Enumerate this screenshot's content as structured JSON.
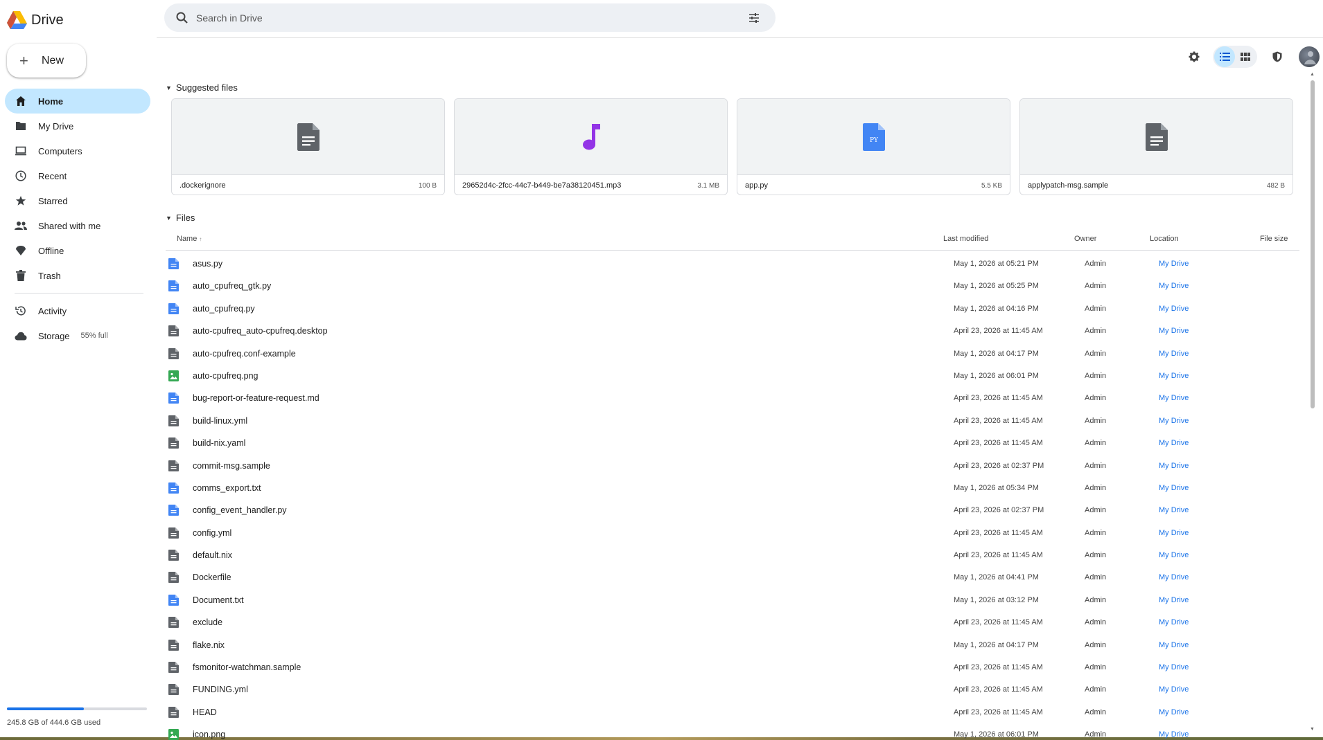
{
  "app": {
    "title": "Drive"
  },
  "sidebar": {
    "new_label": "New",
    "items": [
      {
        "label": "Home",
        "icon": "home-icon",
        "active": true
      },
      {
        "label": "My Drive",
        "icon": "folder-icon"
      },
      {
        "label": "Computers",
        "icon": "computer-icon"
      },
      {
        "label": "Recent",
        "icon": "clock-icon"
      },
      {
        "label": "Starred",
        "icon": "star-icon"
      },
      {
        "label": "Shared with me",
        "icon": "people-icon"
      },
      {
        "label": "Offline",
        "icon": "offline-icon"
      },
      {
        "label": "Trash",
        "icon": "trash-icon"
      }
    ],
    "items2": [
      {
        "label": "Activity",
        "icon": "history-icon"
      },
      {
        "label": "Storage",
        "icon": "cloud-icon",
        "extra": "55% full"
      }
    ],
    "storage_used_fraction": 0.55,
    "storage_text": "245.8 GB of 444.6 GB used"
  },
  "search": {
    "placeholder": "Search in Drive"
  },
  "sections": {
    "suggested": "Suggested files",
    "files": "Files"
  },
  "suggested": [
    {
      "name": ".dockerignore",
      "size": "100 B",
      "icon": "document-icon"
    },
    {
      "name": "29652d4c-2fcc-44c7-b449-be7a38120451.mp3",
      "size": "3.1 MB",
      "icon": "music-icon"
    },
    {
      "name": "app.py",
      "size": "5.5 KB",
      "icon": "python-file-icon"
    },
    {
      "name": "applypatch-msg.sample",
      "size": "482 B",
      "icon": "document-icon"
    }
  ],
  "table": {
    "headers": {
      "name": "Name",
      "sort": "↑",
      "modified": "Last modified",
      "owner": "Owner",
      "location": "Location",
      "size": "File size"
    },
    "rows": [
      {
        "name": "asus.py",
        "modified": "May 1, 2026 at 05:21 PM",
        "owner": "Admin",
        "location": "My Drive",
        "type": "blue"
      },
      {
        "name": "auto_cpufreq_gtk.py",
        "modified": "May 1, 2026 at 05:25 PM",
        "owner": "Admin",
        "location": "My Drive",
        "type": "blue"
      },
      {
        "name": "auto_cpufreq.py",
        "modified": "May 1, 2026 at 04:16 PM",
        "owner": "Admin",
        "location": "My Drive",
        "type": "blue"
      },
      {
        "name": "auto-cpufreq_auto-cpufreq.desktop",
        "modified": "April 23, 2026 at 11:45 AM",
        "owner": "Admin",
        "location": "My Drive",
        "type": "gray"
      },
      {
        "name": "auto-cpufreq.conf-example",
        "modified": "May 1, 2026 at 04:17 PM",
        "owner": "Admin",
        "location": "My Drive",
        "type": "gray"
      },
      {
        "name": "auto-cpufreq.png",
        "modified": "May 1, 2026 at 06:01 PM",
        "owner": "Admin",
        "location": "My Drive",
        "type": "green"
      },
      {
        "name": "bug-report-or-feature-request.md",
        "modified": "April 23, 2026 at 11:45 AM",
        "owner": "Admin",
        "location": "My Drive",
        "type": "blue"
      },
      {
        "name": "build-linux.yml",
        "modified": "April 23, 2026 at 11:45 AM",
        "owner": "Admin",
        "location": "My Drive",
        "type": "gray"
      },
      {
        "name": "build-nix.yaml",
        "modified": "April 23, 2026 at 11:45 AM",
        "owner": "Admin",
        "location": "My Drive",
        "type": "gray"
      },
      {
        "name": "commit-msg.sample",
        "modified": "April 23, 2026 at 02:37 PM",
        "owner": "Admin",
        "location": "My Drive",
        "type": "gray"
      },
      {
        "name": "comms_export.txt",
        "modified": "May 1, 2026 at 05:34 PM",
        "owner": "Admin",
        "location": "My Drive",
        "type": "blue"
      },
      {
        "name": "config_event_handler.py",
        "modified": "April 23, 2026 at 02:37 PM",
        "owner": "Admin",
        "location": "My Drive",
        "type": "blue"
      },
      {
        "name": "config.yml",
        "modified": "April 23, 2026 at 11:45 AM",
        "owner": "Admin",
        "location": "My Drive",
        "type": "gray"
      },
      {
        "name": "default.nix",
        "modified": "April 23, 2026 at 11:45 AM",
        "owner": "Admin",
        "location": "My Drive",
        "type": "gray"
      },
      {
        "name": "Dockerfile",
        "modified": "May 1, 2026 at 04:41 PM",
        "owner": "Admin",
        "location": "My Drive",
        "type": "gray"
      },
      {
        "name": "Document.txt",
        "modified": "May 1, 2026 at 03:12 PM",
        "owner": "Admin",
        "location": "My Drive",
        "type": "blue"
      },
      {
        "name": "exclude",
        "modified": "April 23, 2026 at 11:45 AM",
        "owner": "Admin",
        "location": "My Drive",
        "type": "gray"
      },
      {
        "name": "flake.nix",
        "modified": "May 1, 2026 at 04:17 PM",
        "owner": "Admin",
        "location": "My Drive",
        "type": "gray"
      },
      {
        "name": "fsmonitor-watchman.sample",
        "modified": "April 23, 2026 at 11:45 AM",
        "owner": "Admin",
        "location": "My Drive",
        "type": "gray"
      },
      {
        "name": "FUNDING.yml",
        "modified": "April 23, 2026 at 11:45 AM",
        "owner": "Admin",
        "location": "My Drive",
        "type": "gray"
      },
      {
        "name": "HEAD",
        "modified": "April 23, 2026 at 11:45 AM",
        "owner": "Admin",
        "location": "My Drive",
        "type": "gray"
      },
      {
        "name": "icon.png",
        "modified": "May 1, 2026 at 06:01 PM",
        "owner": "Admin",
        "location": "My Drive",
        "type": "green"
      }
    ]
  },
  "colors": {
    "accent": "#1a73e8",
    "active_nav": "#c2e7ff",
    "search_bg": "#edf0f4",
    "file_gray": "#5f6368",
    "file_blue": "#4285f4",
    "file_green": "#34a853",
    "music": "#9334e6"
  }
}
